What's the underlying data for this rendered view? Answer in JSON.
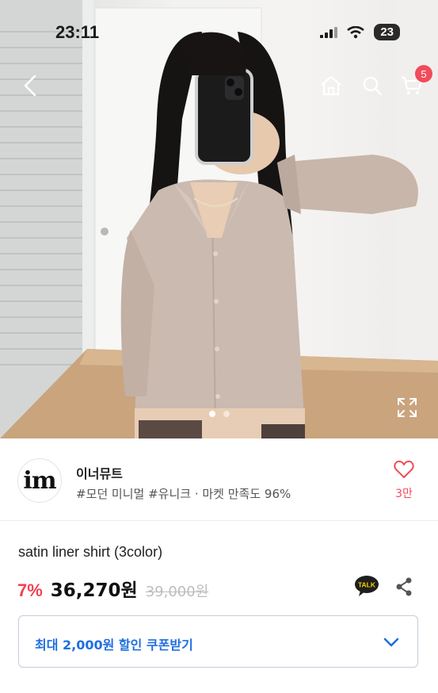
{
  "status_bar": {
    "time": "23:11",
    "battery": "23"
  },
  "nav": {
    "cart_count": "5"
  },
  "carousel": {
    "total": 2,
    "active": 1
  },
  "store": {
    "logo_text": "im",
    "name": "이너뮤트",
    "tags": "#모던 미니멀 #유니크 · 마켓 만족도 96%",
    "like_count": "3만"
  },
  "product": {
    "title": "satin liner shirt (3color)",
    "discount": "7%",
    "price": "36,270원",
    "original_price": "39,000원"
  },
  "coupon": {
    "label": "최대 2,000원 할인 쿠폰받기"
  },
  "colors": {
    "accent_red": "#f24b5a",
    "coupon_blue": "#1f6fe0"
  }
}
